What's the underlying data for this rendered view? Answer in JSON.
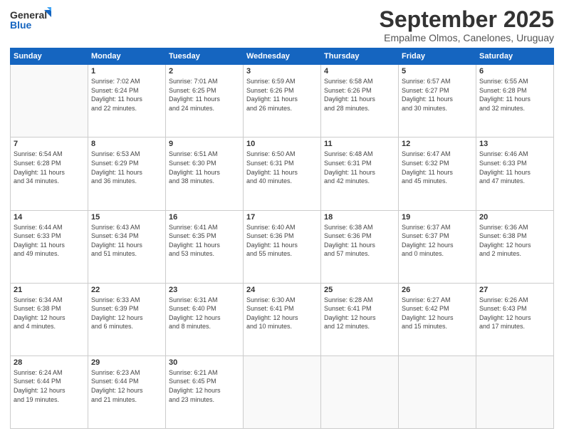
{
  "logo": {
    "line1": "General",
    "line2": "Blue"
  },
  "title": "September 2025",
  "subtitle": "Empalme Olmos, Canelones, Uruguay",
  "days": [
    "Sunday",
    "Monday",
    "Tuesday",
    "Wednesday",
    "Thursday",
    "Friday",
    "Saturday"
  ],
  "weeks": [
    [
      {
        "day": "",
        "text": ""
      },
      {
        "day": "1",
        "text": "Sunrise: 7:02 AM\nSunset: 6:24 PM\nDaylight: 11 hours\nand 22 minutes."
      },
      {
        "day": "2",
        "text": "Sunrise: 7:01 AM\nSunset: 6:25 PM\nDaylight: 11 hours\nand 24 minutes."
      },
      {
        "day": "3",
        "text": "Sunrise: 6:59 AM\nSunset: 6:26 PM\nDaylight: 11 hours\nand 26 minutes."
      },
      {
        "day": "4",
        "text": "Sunrise: 6:58 AM\nSunset: 6:26 PM\nDaylight: 11 hours\nand 28 minutes."
      },
      {
        "day": "5",
        "text": "Sunrise: 6:57 AM\nSunset: 6:27 PM\nDaylight: 11 hours\nand 30 minutes."
      },
      {
        "day": "6",
        "text": "Sunrise: 6:55 AM\nSunset: 6:28 PM\nDaylight: 11 hours\nand 32 minutes."
      }
    ],
    [
      {
        "day": "7",
        "text": "Sunrise: 6:54 AM\nSunset: 6:28 PM\nDaylight: 11 hours\nand 34 minutes."
      },
      {
        "day": "8",
        "text": "Sunrise: 6:53 AM\nSunset: 6:29 PM\nDaylight: 11 hours\nand 36 minutes."
      },
      {
        "day": "9",
        "text": "Sunrise: 6:51 AM\nSunset: 6:30 PM\nDaylight: 11 hours\nand 38 minutes."
      },
      {
        "day": "10",
        "text": "Sunrise: 6:50 AM\nSunset: 6:31 PM\nDaylight: 11 hours\nand 40 minutes."
      },
      {
        "day": "11",
        "text": "Sunrise: 6:48 AM\nSunset: 6:31 PM\nDaylight: 11 hours\nand 42 minutes."
      },
      {
        "day": "12",
        "text": "Sunrise: 6:47 AM\nSunset: 6:32 PM\nDaylight: 11 hours\nand 45 minutes."
      },
      {
        "day": "13",
        "text": "Sunrise: 6:46 AM\nSunset: 6:33 PM\nDaylight: 11 hours\nand 47 minutes."
      }
    ],
    [
      {
        "day": "14",
        "text": "Sunrise: 6:44 AM\nSunset: 6:33 PM\nDaylight: 11 hours\nand 49 minutes."
      },
      {
        "day": "15",
        "text": "Sunrise: 6:43 AM\nSunset: 6:34 PM\nDaylight: 11 hours\nand 51 minutes."
      },
      {
        "day": "16",
        "text": "Sunrise: 6:41 AM\nSunset: 6:35 PM\nDaylight: 11 hours\nand 53 minutes."
      },
      {
        "day": "17",
        "text": "Sunrise: 6:40 AM\nSunset: 6:36 PM\nDaylight: 11 hours\nand 55 minutes."
      },
      {
        "day": "18",
        "text": "Sunrise: 6:38 AM\nSunset: 6:36 PM\nDaylight: 11 hours\nand 57 minutes."
      },
      {
        "day": "19",
        "text": "Sunrise: 6:37 AM\nSunset: 6:37 PM\nDaylight: 12 hours\nand 0 minutes."
      },
      {
        "day": "20",
        "text": "Sunrise: 6:36 AM\nSunset: 6:38 PM\nDaylight: 12 hours\nand 2 minutes."
      }
    ],
    [
      {
        "day": "21",
        "text": "Sunrise: 6:34 AM\nSunset: 6:38 PM\nDaylight: 12 hours\nand 4 minutes."
      },
      {
        "day": "22",
        "text": "Sunrise: 6:33 AM\nSunset: 6:39 PM\nDaylight: 12 hours\nand 6 minutes."
      },
      {
        "day": "23",
        "text": "Sunrise: 6:31 AM\nSunset: 6:40 PM\nDaylight: 12 hours\nand 8 minutes."
      },
      {
        "day": "24",
        "text": "Sunrise: 6:30 AM\nSunset: 6:41 PM\nDaylight: 12 hours\nand 10 minutes."
      },
      {
        "day": "25",
        "text": "Sunrise: 6:28 AM\nSunset: 6:41 PM\nDaylight: 12 hours\nand 12 minutes."
      },
      {
        "day": "26",
        "text": "Sunrise: 6:27 AM\nSunset: 6:42 PM\nDaylight: 12 hours\nand 15 minutes."
      },
      {
        "day": "27",
        "text": "Sunrise: 6:26 AM\nSunset: 6:43 PM\nDaylight: 12 hours\nand 17 minutes."
      }
    ],
    [
      {
        "day": "28",
        "text": "Sunrise: 6:24 AM\nSunset: 6:44 PM\nDaylight: 12 hours\nand 19 minutes."
      },
      {
        "day": "29",
        "text": "Sunrise: 6:23 AM\nSunset: 6:44 PM\nDaylight: 12 hours\nand 21 minutes."
      },
      {
        "day": "30",
        "text": "Sunrise: 6:21 AM\nSunset: 6:45 PM\nDaylight: 12 hours\nand 23 minutes."
      },
      {
        "day": "",
        "text": ""
      },
      {
        "day": "",
        "text": ""
      },
      {
        "day": "",
        "text": ""
      },
      {
        "day": "",
        "text": ""
      }
    ]
  ]
}
